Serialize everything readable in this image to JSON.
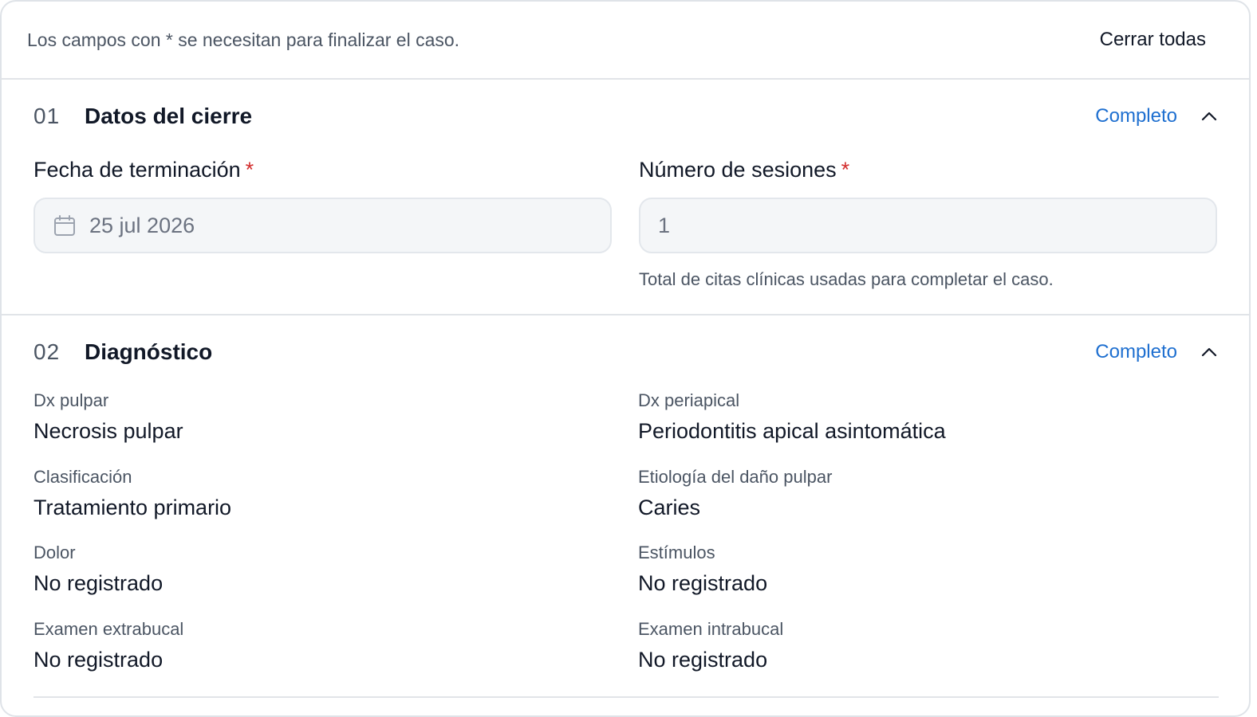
{
  "header": {
    "note": "Los campos con * se necesitan para finalizar el caso.",
    "close_all_label": "Cerrar todas"
  },
  "sections": [
    {
      "number": "01",
      "title": "Datos del cierre",
      "status": "Completo",
      "icon": "chevron-up-icon",
      "fields": {
        "end_date": {
          "label": "Fecha de terminación",
          "required_mark": "*",
          "value": "25 jul 2026",
          "icon": "calendar-icon"
        },
        "sessions": {
          "label": "Número de sesiones",
          "required_mark": "*",
          "value": "1",
          "hint": "Total de citas clínicas usadas para completar el caso."
        }
      }
    },
    {
      "number": "02",
      "title": "Diagnóstico",
      "status": "Completo",
      "icon": "chevron-up-icon",
      "items": [
        {
          "label": "Dx pulpar",
          "value": "Necrosis pulpar"
        },
        {
          "label": "Dx periapical",
          "value": "Periodontitis apical asintomática"
        },
        {
          "label": "Clasificación",
          "value": "Tratamiento primario"
        },
        {
          "label": "Etiología del daño pulpar",
          "value": "Caries"
        },
        {
          "label": "Dolor",
          "value": "No registrado"
        },
        {
          "label": "Estímulos",
          "value": "No registrado"
        },
        {
          "label": "Examen extrabucal",
          "value": "No registrado"
        },
        {
          "label": "Examen intrabucal",
          "value": "No registrado"
        }
      ]
    }
  ],
  "colors": {
    "accent": "#1e6fd0",
    "required": "#d32f2f",
    "border": "#e1e4e8",
    "input_bg": "#f4f6f8"
  }
}
